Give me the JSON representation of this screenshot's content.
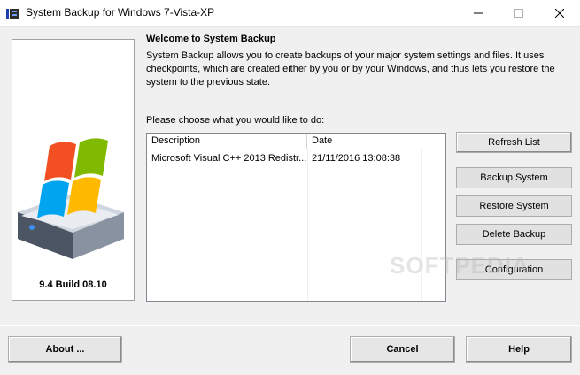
{
  "window": {
    "title": "System Backup for Windows 7-Vista-XP",
    "min_glyph": "—",
    "max_glyph": "☐",
    "close_glyph": "✕"
  },
  "left_panel": {
    "logo_icon": "windows-drive-logo-icon",
    "version": "9.4 Build 08.10"
  },
  "welcome": {
    "title": "Welcome to System Backup",
    "text": "System Backup allows you to create backups of your major system settings and files. It uses checkpoints, which are created either by you or by your Windows, and thus lets you restore the system to the previous state."
  },
  "choose_label": "Please choose what you would like to do:",
  "listview": {
    "columns": [
      "Description",
      "Date",
      ""
    ],
    "rows": [
      {
        "description": "Microsoft Visual C++ 2013 Redistr...",
        "date": "21/11/2016  13:08:38"
      }
    ]
  },
  "side_buttons": {
    "refresh": "Refresh List",
    "backup": "Backup System",
    "restore": "Restore System",
    "delete": "Delete Backup",
    "config": "Configuration"
  },
  "bottom_buttons": {
    "about": "About ...",
    "cancel": "Cancel",
    "help": "Help"
  },
  "watermark": "SOFTPEDIA",
  "colors": {
    "accent": "#0078d7",
    "dialog_bg": "#f0f0f0"
  }
}
